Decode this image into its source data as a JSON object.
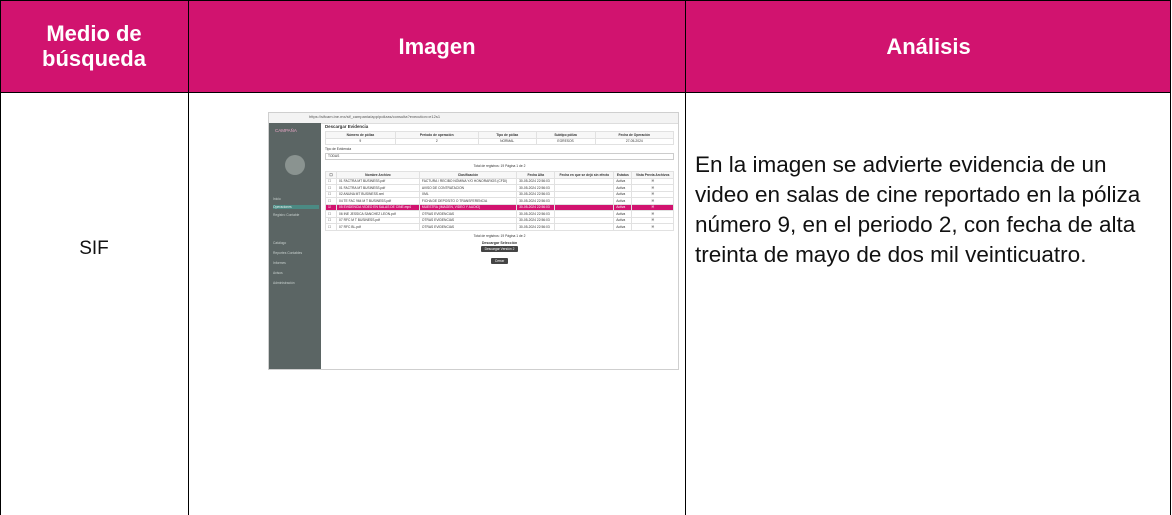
{
  "headers": {
    "col1": "Medio de búsqueda",
    "col2": "Imagen",
    "col3": "Análisis"
  },
  "row": {
    "medio": "SIF",
    "analisis": "En la imagen se advierte evidencia de un video en salas de cine reportado en la póliza número 9, en el periodo 2, con fecha de alta treinta de mayo de dos mil veinticuatro."
  },
  "screenshot": {
    "url": "https://sifcam.ine.mx/sif_campania/app/polizas/consulta?execution=e12s1",
    "brand": "CAMPAÑA",
    "title": "Descargar Evidencia",
    "summary_headers": [
      "Número de póliza",
      "Periodo de operación",
      "Tipo de póliza",
      "Subtipo póliza",
      "Fecha de Operación"
    ],
    "summary_values": [
      "9",
      "2",
      "NORMAL",
      "EGRESOS",
      "27-05-2024"
    ],
    "tipo_label": "Tipo de Evidencia",
    "tipo_value": "TODAS",
    "pager_top": "Total de registros: 19    Página 1 de 2",
    "columns": [
      "Nombre Archivo",
      "Clasificación",
      "Fecha Alta",
      "Fecha en que se dejó sin efecto",
      "Estatus",
      "Vista Previa Archivos"
    ],
    "rows": [
      [
        "01 FACTRA MT BUSINESS.pdf",
        "FACTURA / RECIBO NÓMINA Y/O HONORARIOS (CFDI)",
        "30-05-2024 22:56:03",
        "",
        "Activa"
      ],
      [
        "01 FACTRA MT BUSINESS.pdf",
        "AVISO DE CONTRATACION",
        "30-05-2024 22:56:03",
        "",
        "Activa"
      ],
      [
        "02 ANUNA MT BUSINESS.xml",
        "XML",
        "30-05-2024 22:56:03",
        "",
        "Activa"
      ],
      [
        "04 TE FAC 964 M T BUSINESS.pdf",
        "FICHA DE DEPOSITO O TRANSFERENCIA",
        "30-05-2024 22:56:03",
        "",
        "Activa"
      ],
      [
        "05 EVIDENCIA VIDEO EN SALAS DE CINE.mp4",
        "MUESTRA (IMAGEN, VIDEO Y AUDIO)",
        "30-05-2024 22:56:03",
        "",
        "Activa"
      ],
      [
        "06 INE JESSICA SANCHEZ LEON.pdf",
        "OTRAS EVIDENCIAS",
        "30-05-2024 22:56:03",
        "",
        "Activa"
      ],
      [
        "07 RFC M T BUSINESS.pdf",
        "OTRAS EVIDENCIAS",
        "30-05-2024 22:56:03",
        "",
        "Activa"
      ],
      [
        "07 RFC BL.pdf",
        "OTRAS EVIDENCIAS",
        "30-05-2024 22:56:03",
        "",
        "Activa"
      ]
    ],
    "pager_bottom": "Total de registros: 19    Página 1 de 2",
    "download_title": "Descargar Selección",
    "download_btn": "Descargar Versión 2",
    "close_btn": "Cerrar",
    "sidebar_items": [
      "Inicio",
      "Operaciones",
      "Registro Contable",
      "Catálogo",
      "Reportes Contables",
      "Informes",
      "Avisos",
      "Administración"
    ]
  }
}
